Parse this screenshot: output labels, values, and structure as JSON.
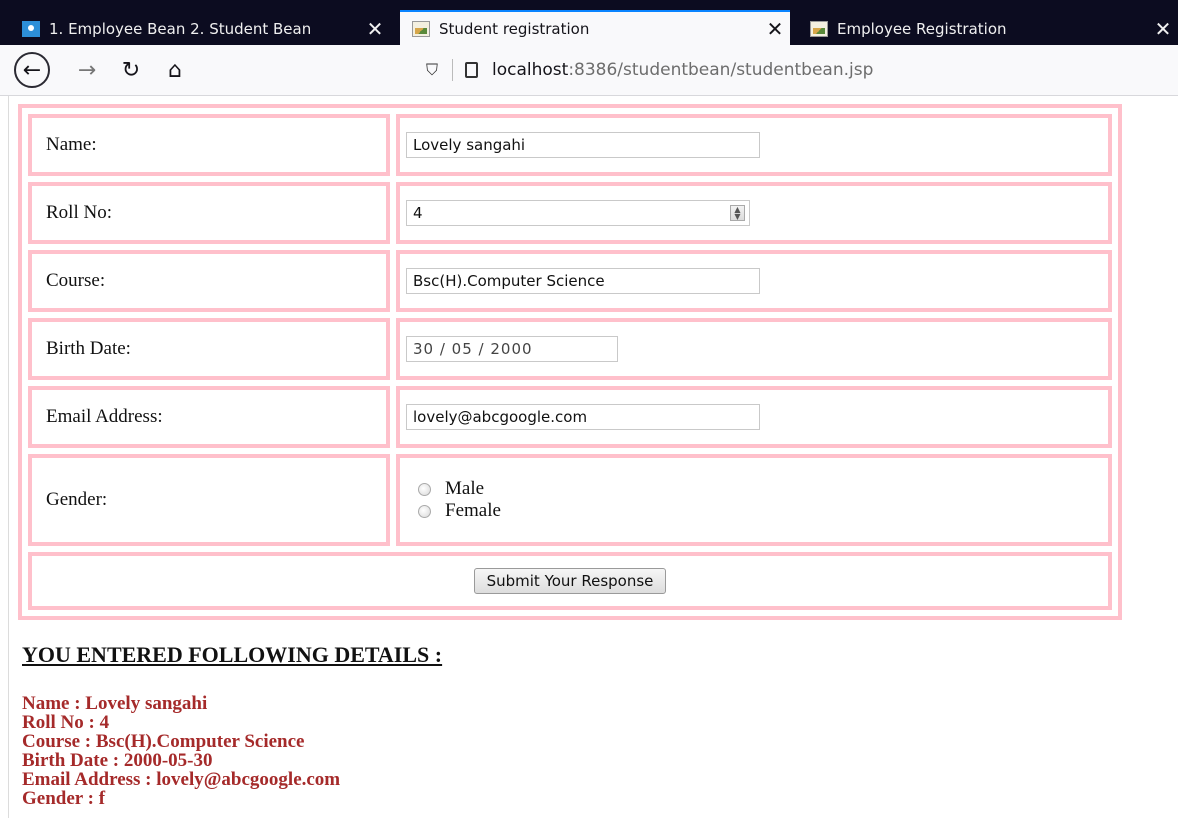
{
  "browser": {
    "tabs": [
      {
        "title": "1. Employee Bean 2. Student Bean",
        "active": false
      },
      {
        "title": "Student registration",
        "active": true
      },
      {
        "title": "Employee Registration",
        "active": false
      }
    ],
    "close_glyph": "✕",
    "url": {
      "host": "localhost",
      "rest": ":8386/studentbean/studentbean.jsp"
    },
    "icons": {
      "back": "arrow-left-icon",
      "forward": "arrow-right-icon",
      "reload": "reload-icon",
      "home": "home-icon",
      "shield": "shield-icon",
      "page": "page-icon"
    }
  },
  "form": {
    "rows": {
      "name": {
        "label": "Name:",
        "value": "Lovely sangahi"
      },
      "roll": {
        "label": "Roll No:",
        "value": "4"
      },
      "course": {
        "label": "Course:",
        "value": "Bsc(H).Computer Science"
      },
      "birth": {
        "label": "Birth Date:",
        "value": "30 / 05 / 2000"
      },
      "email": {
        "label": "Email Address:",
        "value": "lovely@abcgoogle.com"
      },
      "gender": {
        "label": "Gender:",
        "options": [
          "Male",
          "Female"
        ]
      }
    },
    "submit_label": "Submit Your Response",
    "border_color": "#ffc0cb"
  },
  "results": {
    "heading": "YOU ENTERED FOLLOWING DETAILS :",
    "lines": [
      "Name : Lovely sangahi",
      "Roll No : 4",
      "Course : Bsc(H).Computer Science",
      "Birth Date : 2000-05-30",
      "Email Address : lovely@abcgoogle.com",
      "Gender : f"
    ],
    "color": "#a52a2a"
  }
}
